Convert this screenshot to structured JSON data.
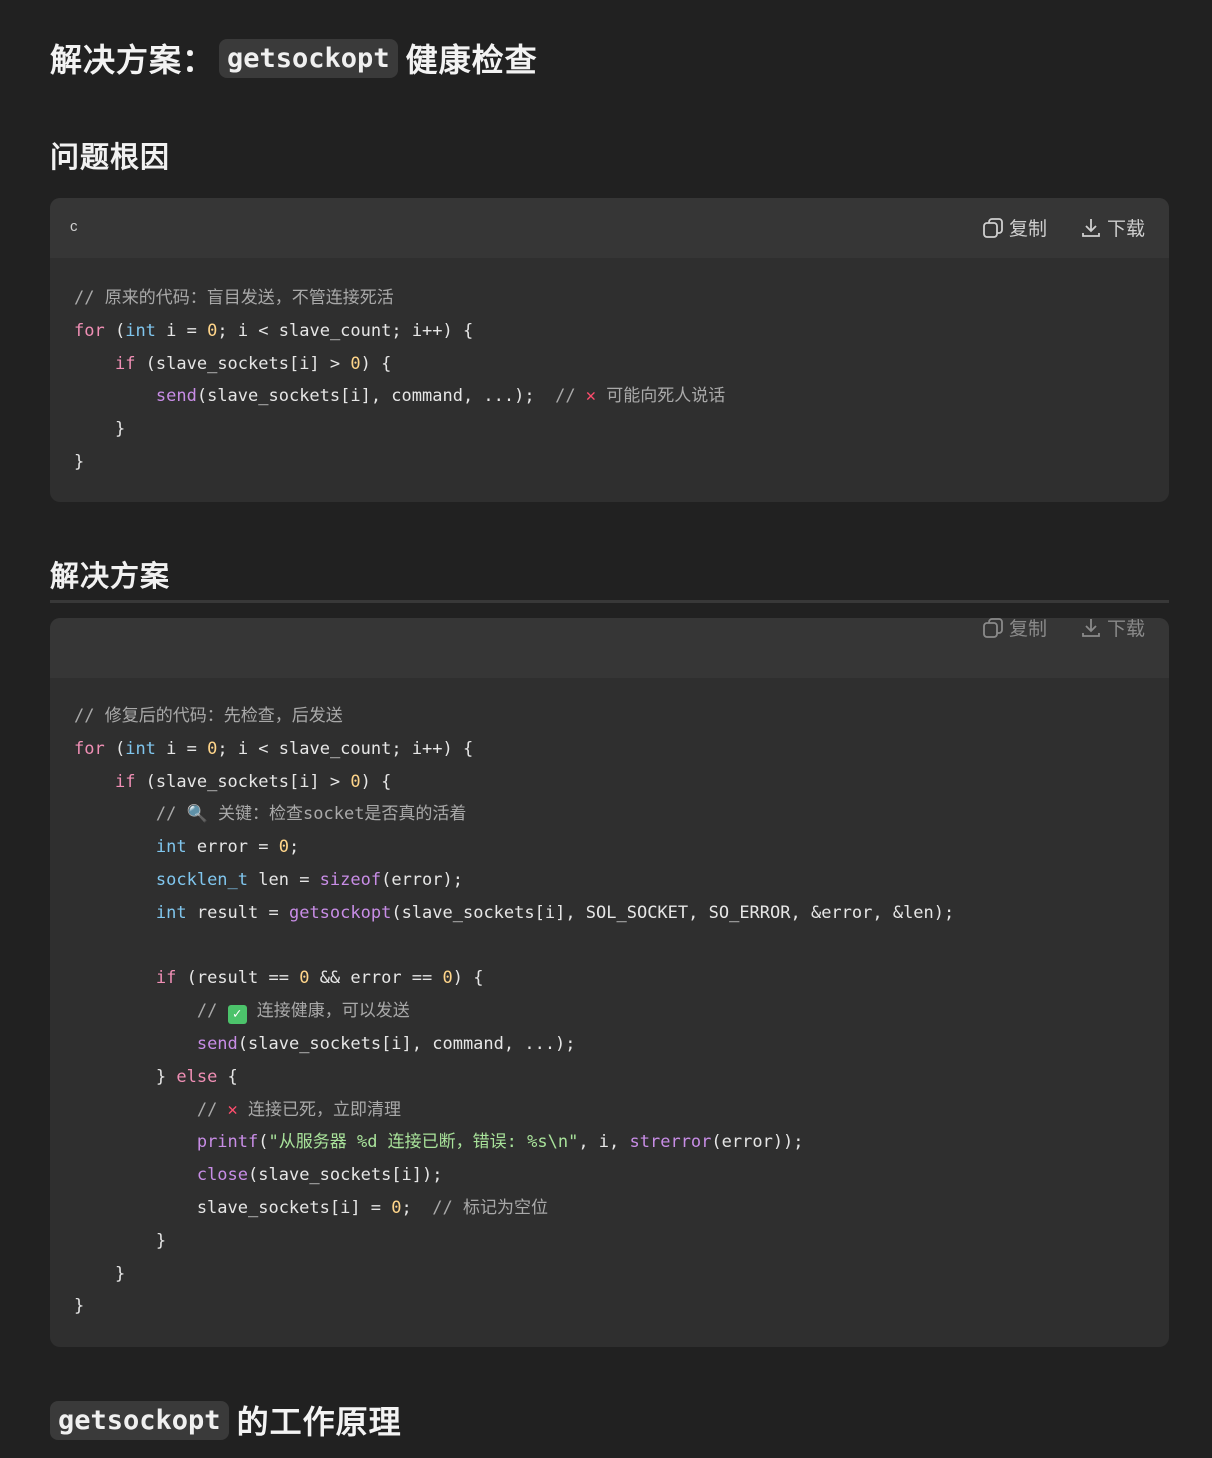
{
  "title": {
    "prefix": "解决方案：",
    "code": "getsockopt",
    "suffix": "健康检查"
  },
  "section1": {
    "heading": "问题根因",
    "codeblock": {
      "lang": "c",
      "copy_label": "复制",
      "download_label": "下载"
    }
  },
  "section2": {
    "heading": "解决方案",
    "codeblock": {
      "copy_label": "复制",
      "download_label": "下载"
    }
  },
  "section3": {
    "code": "getsockopt",
    "suffix": "的工作原理"
  },
  "colors": {
    "background": "#212121",
    "code_bg": "#2f2f2f",
    "keyword": "#f08fb5",
    "type": "#80c6ee",
    "function": "#c88de6",
    "string": "#a8e29a"
  },
  "icons": [
    "copy-icon",
    "download-icon",
    "cross-mark-icon",
    "magnifier-icon",
    "check-mark-icon"
  ]
}
